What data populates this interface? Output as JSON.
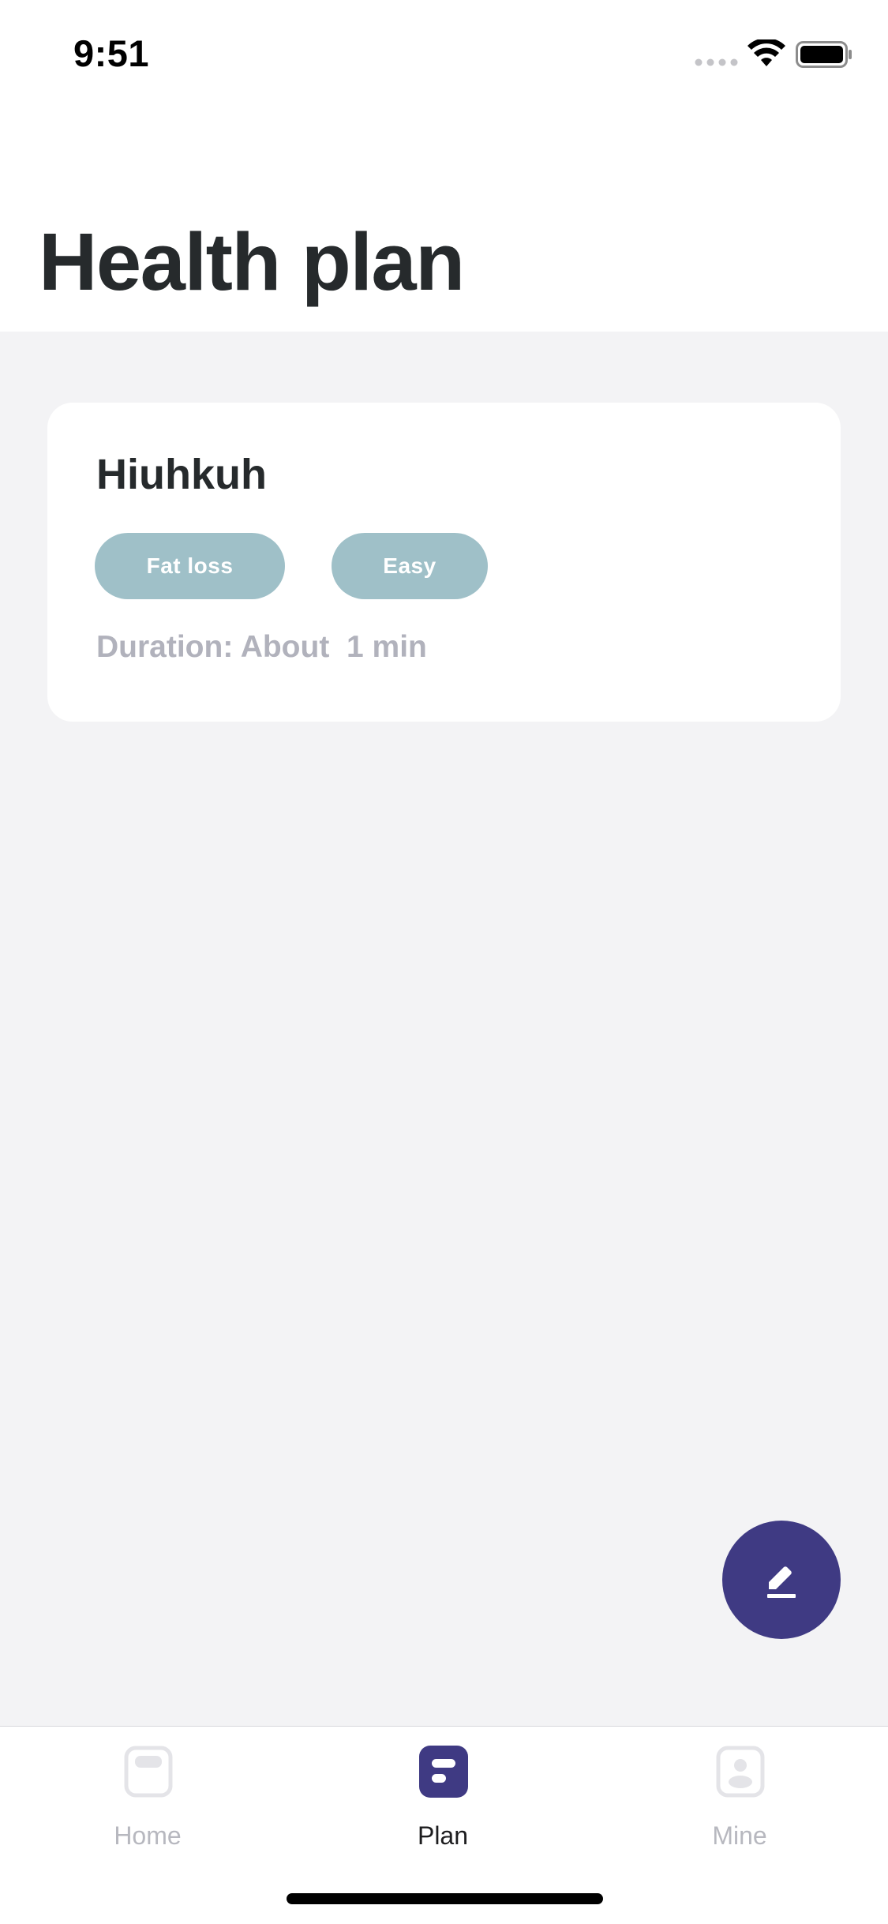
{
  "status_bar": {
    "time": "9:51"
  },
  "header": {
    "title": "Health plan"
  },
  "plans": [
    {
      "name": "Hiuhkuh",
      "tags": [
        "Fat loss",
        "Easy"
      ],
      "duration": "Duration: About  1 min"
    }
  ],
  "fab": {
    "icon": "edit-icon"
  },
  "tab_bar": {
    "items": [
      {
        "label": "Home",
        "icon": "home-icon",
        "active": false
      },
      {
        "label": "Plan",
        "icon": "plan-icon",
        "active": true
      },
      {
        "label": "Mine",
        "icon": "mine-icon",
        "active": false
      }
    ]
  },
  "colors": {
    "accent": "#3f3a83",
    "tag_background": "#9fc0c8",
    "background": "#f3f3f5",
    "muted_text": "#b1b2bc"
  }
}
